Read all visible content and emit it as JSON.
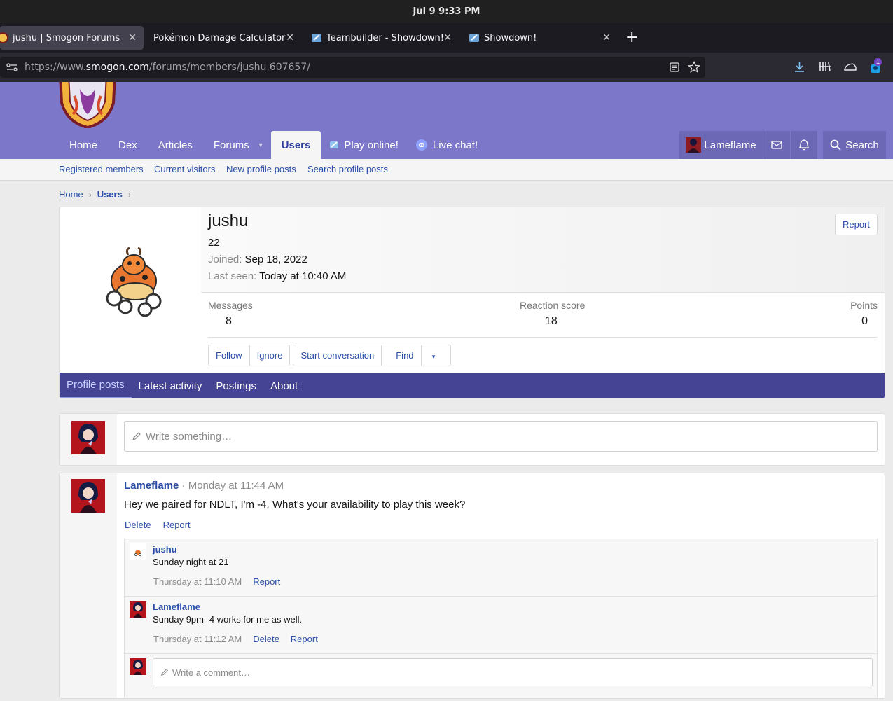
{
  "os": {
    "clock": "Jul 9   9:33 PM"
  },
  "browser": {
    "tabs": [
      {
        "label": "jushu | Smogon Forums"
      },
      {
        "label": "Pokémon Damage Calculator"
      },
      {
        "label": "Teambuilder - Showdown!"
      },
      {
        "label": "Showdown!"
      }
    ],
    "url_prefix": "https://www.",
    "url_domain": "smogon.com",
    "url_path": "/forums/members/jushu.607657/",
    "downloads_badge": "1"
  },
  "nav": {
    "items": [
      "Home",
      "Dex",
      "Articles",
      "Forums",
      "Users",
      "Play online!",
      "Live chat!"
    ],
    "account_name": "Lameflame",
    "search_label": "Search"
  },
  "subnav": [
    "Registered members",
    "Current visitors",
    "New profile posts",
    "Search profile posts"
  ],
  "breadcrumb": [
    "Home",
    "Users"
  ],
  "profile": {
    "username": "jushu",
    "age": "22",
    "joined_label": "Joined:",
    "joined_value": "Sep 18, 2022",
    "lastseen_label": "Last seen:",
    "lastseen_value": "Today at 10:40 AM",
    "report_label": "Report",
    "stats": [
      {
        "label": "Messages",
        "value": "8"
      },
      {
        "label": "Reaction score",
        "value": "18"
      },
      {
        "label": "Points",
        "value": "0"
      }
    ],
    "buttons": {
      "follow": "Follow",
      "ignore": "Ignore",
      "start_conversation": "Start conversation",
      "find": "Find"
    },
    "tabs": [
      "Profile posts",
      "Latest activity",
      "Postings",
      "About"
    ]
  },
  "write_box": {
    "placeholder": "Write something…"
  },
  "post": {
    "author": "Lameflame",
    "meta": "· Monday at 11:44 AM",
    "text": "Hey we paired for NDLT, I'm -4. What's your availability to play this week?",
    "actions": [
      "Delete",
      "Report"
    ],
    "comments": [
      {
        "author": "jushu",
        "text": "Sunday night at 21",
        "time": "Thursday at 11:10 AM",
        "actions": [
          "Report"
        ]
      },
      {
        "author": "Lameflame",
        "text": "Sunday 9pm -4 works for me as well.",
        "time": "Thursday at 11:12 AM",
        "actions": [
          "Delete",
          "Report"
        ]
      }
    ],
    "comment_placeholder": "Write a comment…"
  },
  "colors": {
    "header": "#7c77c9",
    "profile_tabs": "#454394",
    "link": "#2a4da8"
  }
}
